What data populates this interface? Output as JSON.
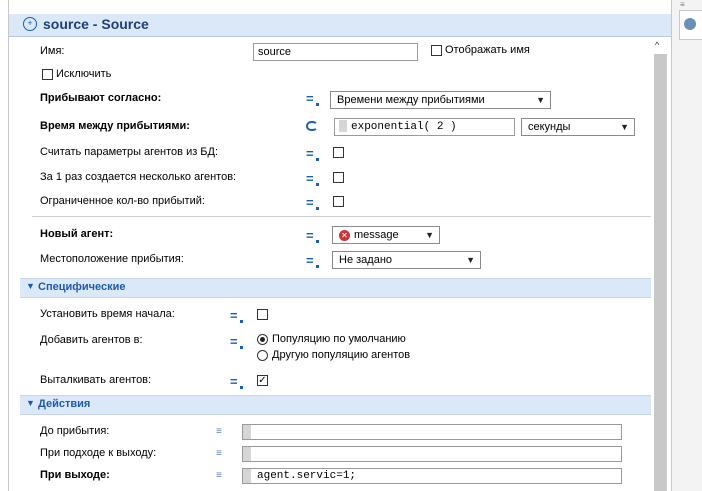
{
  "title": "source - Source",
  "fields": {
    "name_label": "Имя:",
    "name_value": "source",
    "show_name_label": "Отображать имя",
    "exclude_label": "Исключить",
    "arrive_label": "Прибывают согласно:",
    "arrive_value": "Времени между прибытиями",
    "interarrival_label": "Время между прибытиями:",
    "interarrival_value": "exponential( 2 )",
    "interarrival_unit": "секунды",
    "read_db_label": "Считать параметры агентов из БД:",
    "multiple_label": "За 1 раз создается несколько агентов:",
    "limited_label": "Ограниченное кол-во прибытий:",
    "new_agent_label": "Новый агент:",
    "new_agent_value": "message",
    "location_label": "Местоположение прибытия:",
    "location_value": "Не задано"
  },
  "specific": {
    "section_title": "Специфические",
    "start_time_label": "Установить время начала:",
    "add_agents_label": "Добавить агентов в:",
    "radio_default": "Популяцию по умолчанию",
    "radio_other": "Другую популяцию агентов",
    "push_label": "Выталкивать агентов:"
  },
  "actions": {
    "section_title": "Действия",
    "before_label": "До прибытия:",
    "before_value": "",
    "exit_approach_label": "При подходе к выходу:",
    "exit_approach_value": "",
    "on_exit_label": "При выходе:",
    "on_exit_value": "agent.servic=1;"
  },
  "state": {
    "show_name_checked": false,
    "exclude_checked": false,
    "read_db_checked": false,
    "multiple_checked": false,
    "limited_checked": false,
    "start_time_checked": false,
    "add_to": "Популяцию по умолчанию",
    "push_checked": true
  },
  "colors": {
    "section_bg": "#dbe8f8",
    "section_text": "#1f5aa8",
    "title_text": "#1f3f77",
    "accent": "#1a5fb4"
  },
  "icons": {
    "title": "source-block-icon",
    "static_value": "equals-icon",
    "dynamic_value": "refresh-icon",
    "action": "list-icon",
    "agent_type": "agent-type-icon",
    "dropdown": "chevron-down-icon",
    "scroll": "scroll-up-arrow"
  }
}
